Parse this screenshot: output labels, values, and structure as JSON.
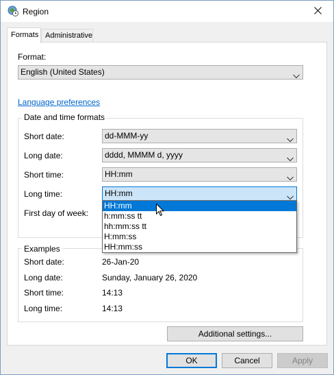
{
  "window": {
    "title": "Region"
  },
  "tabs": [
    {
      "label": "Formats",
      "active": true
    },
    {
      "label": "Administrative",
      "active": false
    }
  ],
  "format": {
    "label": "Format:",
    "value": "English (United States)"
  },
  "language_link": "Language preferences",
  "date_time_formats": {
    "title": "Date and time formats",
    "short_date": {
      "label": "Short date:",
      "value": "dd-MMM-yy"
    },
    "long_date": {
      "label": "Long date:",
      "value": "dddd, MMMM d, yyyy"
    },
    "short_time": {
      "label": "Short time:",
      "value": "HH:mm"
    },
    "long_time": {
      "label": "Long time:",
      "value": "HH:mm"
    },
    "first_day": {
      "label": "First day of week:"
    }
  },
  "long_time_options": [
    "HH:mm",
    "h:mm:ss tt",
    "hh:mm:ss tt",
    "H:mm:ss",
    "HH:mm:ss"
  ],
  "examples": {
    "title": "Examples",
    "short_date": {
      "label": "Short date:",
      "value": "26-Jan-20"
    },
    "long_date": {
      "label": "Long date:",
      "value": "Sunday, January 26, 2020"
    },
    "short_time": {
      "label": "Short time:",
      "value": "14:13"
    },
    "long_time": {
      "label": "Long time:",
      "value": "14:13"
    }
  },
  "buttons": {
    "additional": "Additional settings...",
    "ok": "OK",
    "cancel": "Cancel",
    "apply": "Apply"
  },
  "colors": {
    "accent": "#0078d7",
    "link": "#0066cc",
    "combo_bg": "#e5e5e5"
  }
}
